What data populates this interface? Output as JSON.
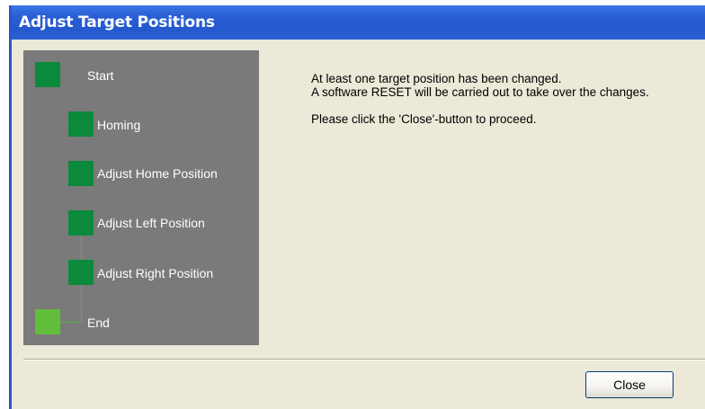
{
  "window": {
    "title": "Adjust Target Positions"
  },
  "steps": [
    {
      "label": "Start",
      "status": "completed",
      "color": "#0B8A3C"
    },
    {
      "label": "Homing",
      "status": "completed",
      "color": "#0B8A3C"
    },
    {
      "label": "Adjust Home Position",
      "status": "completed",
      "color": "#0B8A3C"
    },
    {
      "label": "Adjust Left Position",
      "status": "completed",
      "color": "#0B8A3C"
    },
    {
      "label": "Adjust Right Position",
      "status": "completed",
      "color": "#0B8A3C"
    },
    {
      "label": "End",
      "status": "current",
      "color": "#62BE3A"
    }
  ],
  "message": {
    "line1": "At least one target position has been changed.",
    "line2": "A software RESET will be carried out to take over the changes.",
    "line3": "Please click the 'Close'-button to proceed."
  },
  "buttons": {
    "close_label": "Close"
  },
  "colors": {
    "titlebar": "#2458CF",
    "panel": "#7A7A7A",
    "step_done": "#0B8A3C",
    "step_end": "#62BE3A",
    "dialog_bg": "#ECE9D8"
  }
}
